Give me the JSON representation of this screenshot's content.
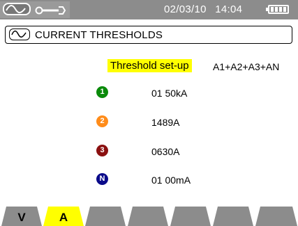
{
  "statusbar": {
    "mode_icon": "waveform-icon",
    "setup_icon": "wrench-icon",
    "date": "02/03/10",
    "time": "14:04",
    "battery_icon": "battery-icon",
    "battery_level": 1.0
  },
  "header": {
    "icon": "waveform-icon",
    "title": "CURRENT THRESHOLDS"
  },
  "threshold": {
    "label": "Threshold set-up",
    "selection": "A1+A2+A3+AN"
  },
  "rows": [
    {
      "badge": "1",
      "color": "#0a8a0a",
      "value": "01 50kA"
    },
    {
      "badge": "2",
      "color": "#ff8c1a",
      "value": "1489A"
    },
    {
      "badge": "3",
      "color": "#8b1010",
      "value": "0630A"
    },
    {
      "badge": "N",
      "color": "#0a0a8a",
      "value": "01 00mA"
    }
  ],
  "tabs": [
    {
      "label": "V",
      "active": false
    },
    {
      "label": "A",
      "active": true
    },
    {
      "label": "",
      "active": false
    },
    {
      "label": "",
      "active": false
    },
    {
      "label": "",
      "active": false
    },
    {
      "label": "",
      "active": false
    },
    {
      "label": "",
      "active": false
    }
  ],
  "colors": {
    "statusbar": "#8c8c8c",
    "highlight": "#ffff00",
    "tab_inactive": "#8c8c8c"
  }
}
